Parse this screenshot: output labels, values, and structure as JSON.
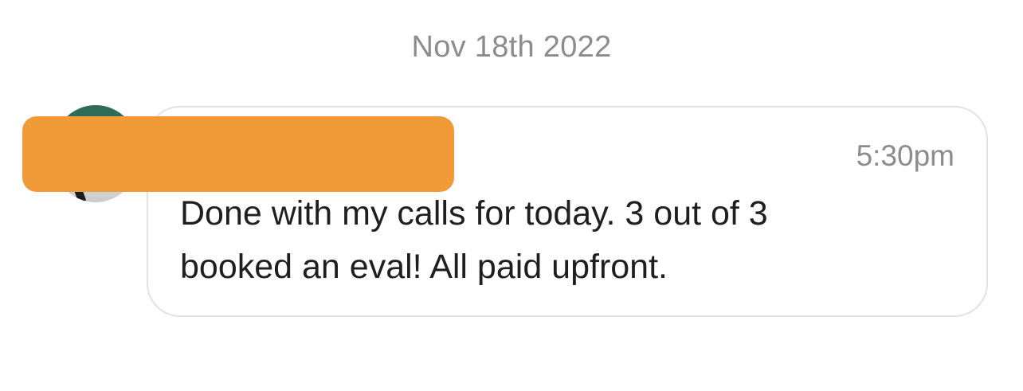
{
  "conversation": {
    "date_divider": "Nov 18th 2022"
  },
  "message": {
    "time": "5:30pm",
    "text": "Done with my calls for today. 3 out of 3 booked an eval! All paid upfront.",
    "redaction_color": "#f09a38"
  }
}
